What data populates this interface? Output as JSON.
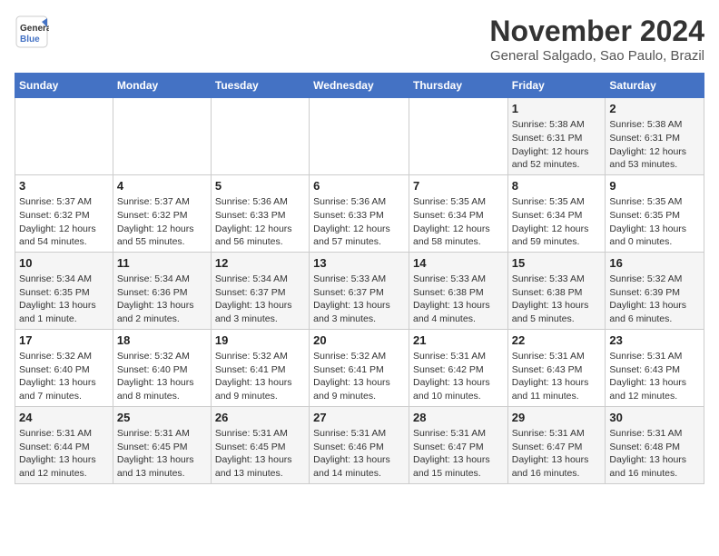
{
  "header": {
    "logo_general": "General",
    "logo_blue": "Blue",
    "month_title": "November 2024",
    "location": "General Salgado, Sao Paulo, Brazil"
  },
  "weekdays": [
    "Sunday",
    "Monday",
    "Tuesday",
    "Wednesday",
    "Thursday",
    "Friday",
    "Saturday"
  ],
  "weeks": [
    [
      {
        "day": "",
        "sunrise": "",
        "sunset": "",
        "daylight": ""
      },
      {
        "day": "",
        "sunrise": "",
        "sunset": "",
        "daylight": ""
      },
      {
        "day": "",
        "sunrise": "",
        "sunset": "",
        "daylight": ""
      },
      {
        "day": "",
        "sunrise": "",
        "sunset": "",
        "daylight": ""
      },
      {
        "day": "",
        "sunrise": "",
        "sunset": "",
        "daylight": ""
      },
      {
        "day": "1",
        "sunrise": "5:38 AM",
        "sunset": "6:31 PM",
        "daylight": "12 hours and 52 minutes."
      },
      {
        "day": "2",
        "sunrise": "5:38 AM",
        "sunset": "6:31 PM",
        "daylight": "12 hours and 53 minutes."
      }
    ],
    [
      {
        "day": "3",
        "sunrise": "5:37 AM",
        "sunset": "6:32 PM",
        "daylight": "12 hours and 54 minutes."
      },
      {
        "day": "4",
        "sunrise": "5:37 AM",
        "sunset": "6:32 PM",
        "daylight": "12 hours and 55 minutes."
      },
      {
        "day": "5",
        "sunrise": "5:36 AM",
        "sunset": "6:33 PM",
        "daylight": "12 hours and 56 minutes."
      },
      {
        "day": "6",
        "sunrise": "5:36 AM",
        "sunset": "6:33 PM",
        "daylight": "12 hours and 57 minutes."
      },
      {
        "day": "7",
        "sunrise": "5:35 AM",
        "sunset": "6:34 PM",
        "daylight": "12 hours and 58 minutes."
      },
      {
        "day": "8",
        "sunrise": "5:35 AM",
        "sunset": "6:34 PM",
        "daylight": "12 hours and 59 minutes."
      },
      {
        "day": "9",
        "sunrise": "5:35 AM",
        "sunset": "6:35 PM",
        "daylight": "13 hours and 0 minutes."
      }
    ],
    [
      {
        "day": "10",
        "sunrise": "5:34 AM",
        "sunset": "6:35 PM",
        "daylight": "13 hours and 1 minute."
      },
      {
        "day": "11",
        "sunrise": "5:34 AM",
        "sunset": "6:36 PM",
        "daylight": "13 hours and 2 minutes."
      },
      {
        "day": "12",
        "sunrise": "5:34 AM",
        "sunset": "6:37 PM",
        "daylight": "13 hours and 3 minutes."
      },
      {
        "day": "13",
        "sunrise": "5:33 AM",
        "sunset": "6:37 PM",
        "daylight": "13 hours and 3 minutes."
      },
      {
        "day": "14",
        "sunrise": "5:33 AM",
        "sunset": "6:38 PM",
        "daylight": "13 hours and 4 minutes."
      },
      {
        "day": "15",
        "sunrise": "5:33 AM",
        "sunset": "6:38 PM",
        "daylight": "13 hours and 5 minutes."
      },
      {
        "day": "16",
        "sunrise": "5:32 AM",
        "sunset": "6:39 PM",
        "daylight": "13 hours and 6 minutes."
      }
    ],
    [
      {
        "day": "17",
        "sunrise": "5:32 AM",
        "sunset": "6:40 PM",
        "daylight": "13 hours and 7 minutes."
      },
      {
        "day": "18",
        "sunrise": "5:32 AM",
        "sunset": "6:40 PM",
        "daylight": "13 hours and 8 minutes."
      },
      {
        "day": "19",
        "sunrise": "5:32 AM",
        "sunset": "6:41 PM",
        "daylight": "13 hours and 9 minutes."
      },
      {
        "day": "20",
        "sunrise": "5:32 AM",
        "sunset": "6:41 PM",
        "daylight": "13 hours and 9 minutes."
      },
      {
        "day": "21",
        "sunrise": "5:31 AM",
        "sunset": "6:42 PM",
        "daylight": "13 hours and 10 minutes."
      },
      {
        "day": "22",
        "sunrise": "5:31 AM",
        "sunset": "6:43 PM",
        "daylight": "13 hours and 11 minutes."
      },
      {
        "day": "23",
        "sunrise": "5:31 AM",
        "sunset": "6:43 PM",
        "daylight": "13 hours and 12 minutes."
      }
    ],
    [
      {
        "day": "24",
        "sunrise": "5:31 AM",
        "sunset": "6:44 PM",
        "daylight": "13 hours and 12 minutes."
      },
      {
        "day": "25",
        "sunrise": "5:31 AM",
        "sunset": "6:45 PM",
        "daylight": "13 hours and 13 minutes."
      },
      {
        "day": "26",
        "sunrise": "5:31 AM",
        "sunset": "6:45 PM",
        "daylight": "13 hours and 13 minutes."
      },
      {
        "day": "27",
        "sunrise": "5:31 AM",
        "sunset": "6:46 PM",
        "daylight": "13 hours and 14 minutes."
      },
      {
        "day": "28",
        "sunrise": "5:31 AM",
        "sunset": "6:47 PM",
        "daylight": "13 hours and 15 minutes."
      },
      {
        "day": "29",
        "sunrise": "5:31 AM",
        "sunset": "6:47 PM",
        "daylight": "13 hours and 16 minutes."
      },
      {
        "day": "30",
        "sunrise": "5:31 AM",
        "sunset": "6:48 PM",
        "daylight": "13 hours and 16 minutes."
      }
    ]
  ]
}
